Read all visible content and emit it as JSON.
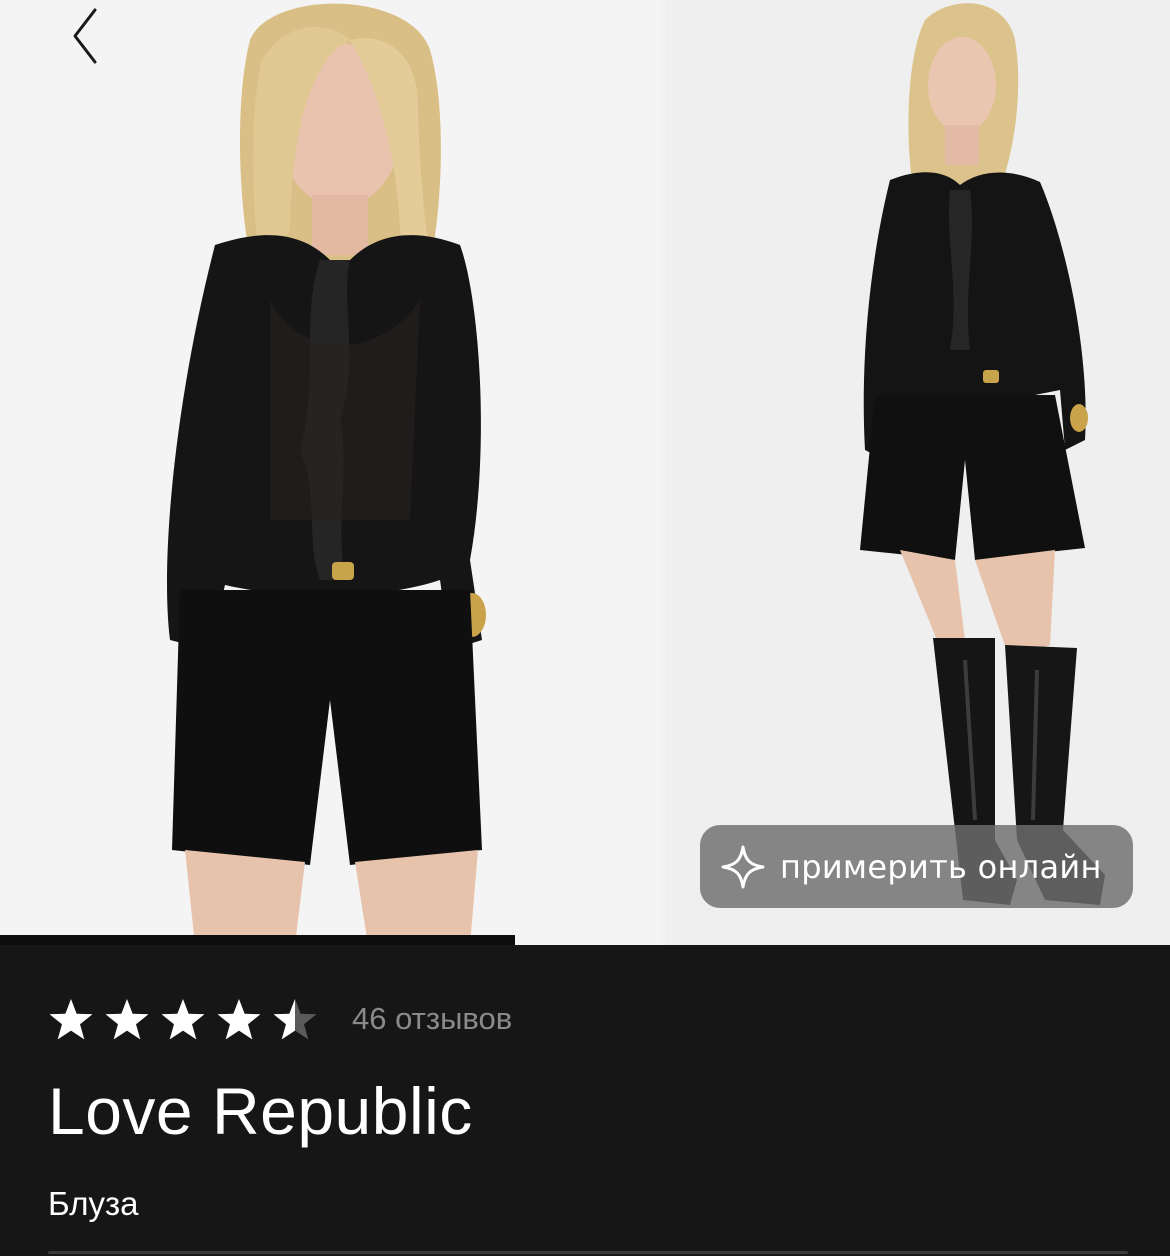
{
  "gallery": {
    "photos": [
      "model-front-photo",
      "model-full-body-photo"
    ],
    "active_index": 0
  },
  "try_on": {
    "label": "примерить онлайн",
    "icon": "sparkle-icon"
  },
  "rating": {
    "value": 4.5,
    "max": 5,
    "reviews_label": "46 отзывов",
    "star_color": "#ffffff"
  },
  "product": {
    "brand": "Love Republic",
    "type": "Блуза"
  },
  "colors": {
    "background": "#161616",
    "accent": "#ffffff",
    "muted": "#8a8a8a"
  }
}
